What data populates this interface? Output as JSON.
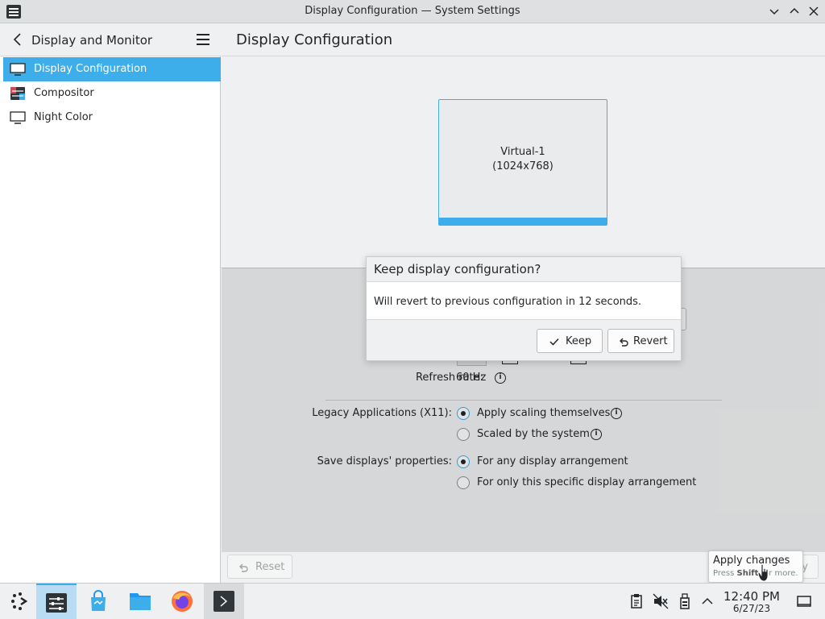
{
  "window": {
    "title": "Display Configuration — System Settings"
  },
  "sidebar": {
    "header_title": "Display and Monitor",
    "items": [
      {
        "label": "Display Configuration",
        "icon": "monitor-icon",
        "active": true
      },
      {
        "label": "Compositor",
        "icon": "compositor-icon",
        "active": false
      },
      {
        "label": "Night Color",
        "icon": "monitor-icon",
        "active": false
      }
    ]
  },
  "main": {
    "title": "Display Configuration",
    "screen": {
      "name": "Virtual-1",
      "resolution": "(1024x768)"
    },
    "refresh_rate_label": "Refresh rate:",
    "refresh_rate_value": "60 Hz",
    "legacy_label": "Legacy Applications (X11):",
    "legacy_options": [
      {
        "label": "Apply scaling themselves",
        "checked": true
      },
      {
        "label": "Scaled by the system",
        "checked": false
      }
    ],
    "save_label": "Save displays' properties:",
    "save_options": [
      {
        "label": "For any display arrangement",
        "checked": true
      },
      {
        "label": "For only this specific display arrangement",
        "checked": false
      }
    ]
  },
  "dialog": {
    "title": "Keep display configuration?",
    "message": "Will revert to previous configuration in 12 seconds.",
    "keep_label": "Keep",
    "revert_label": "Revert"
  },
  "actions": {
    "reset_label": "Reset",
    "apply_label": "y"
  },
  "tooltip": {
    "title": "Apply changes",
    "hint_prefix": "Press ",
    "hint_key": "Shift",
    "hint_suffix": " for more."
  },
  "taskbar": {
    "time": "12:40 PM",
    "date": "6/27/23"
  },
  "colors": {
    "accent": "#3daee9",
    "window_bg": "#eff0f1",
    "view_bg": "#ffffff",
    "text": "#232629"
  }
}
